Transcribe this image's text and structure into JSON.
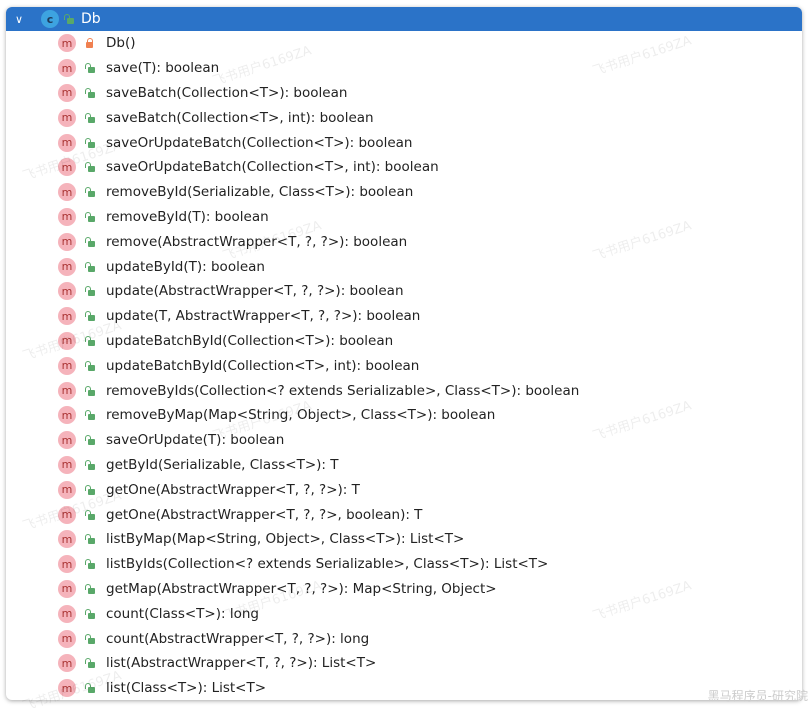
{
  "class": {
    "name": "Db",
    "icon": "class-icon"
  },
  "methods": [
    {
      "label": "Db()",
      "access": "private"
    },
    {
      "label": "save(T): boolean",
      "access": "public"
    },
    {
      "label": "saveBatch(Collection<T>): boolean",
      "access": "public"
    },
    {
      "label": "saveBatch(Collection<T>, int): boolean",
      "access": "public"
    },
    {
      "label": "saveOrUpdateBatch(Collection<T>): boolean",
      "access": "public"
    },
    {
      "label": "saveOrUpdateBatch(Collection<T>, int): boolean",
      "access": "public"
    },
    {
      "label": "removeById(Serializable, Class<T>): boolean",
      "access": "public"
    },
    {
      "label": "removeById(T): boolean",
      "access": "public"
    },
    {
      "label": "remove(AbstractWrapper<T, ?, ?>): boolean",
      "access": "public"
    },
    {
      "label": "updateById(T): boolean",
      "access": "public"
    },
    {
      "label": "update(AbstractWrapper<T, ?, ?>): boolean",
      "access": "public"
    },
    {
      "label": "update(T, AbstractWrapper<T, ?, ?>): boolean",
      "access": "public"
    },
    {
      "label": "updateBatchById(Collection<T>): boolean",
      "access": "public"
    },
    {
      "label": "updateBatchById(Collection<T>, int): boolean",
      "access": "public"
    },
    {
      "label": "removeByIds(Collection<? extends Serializable>, Class<T>): boolean",
      "access": "public"
    },
    {
      "label": "removeByMap(Map<String, Object>, Class<T>): boolean",
      "access": "public"
    },
    {
      "label": "saveOrUpdate(T): boolean",
      "access": "public"
    },
    {
      "label": "getById(Serializable, Class<T>): T",
      "access": "public"
    },
    {
      "label": "getOne(AbstractWrapper<T, ?, ?>): T",
      "access": "public"
    },
    {
      "label": "getOne(AbstractWrapper<T, ?, ?>, boolean): T",
      "access": "public"
    },
    {
      "label": "listByMap(Map<String, Object>, Class<T>): List<T>",
      "access": "public"
    },
    {
      "label": "listByIds(Collection<? extends Serializable>, Class<T>): List<T>",
      "access": "public"
    },
    {
      "label": "getMap(AbstractWrapper<T, ?, ?>): Map<String, Object>",
      "access": "public"
    },
    {
      "label": "count(Class<T>): long",
      "access": "public"
    },
    {
      "label": "count(AbstractWrapper<T, ?, ?>): long",
      "access": "public"
    },
    {
      "label": "list(AbstractWrapper<T, ?, ?>): List<T>",
      "access": "public"
    },
    {
      "label": "list(Class<T>): List<T>",
      "access": "public"
    }
  ],
  "watermark": "飞书用户6169ZA",
  "footer_watermark": "黑马程序员-研究院",
  "colors": {
    "header": "#2b73c8",
    "method_badge": "#f5b3bb",
    "public_lock": "#59a869",
    "private_lock": "#f08050"
  }
}
